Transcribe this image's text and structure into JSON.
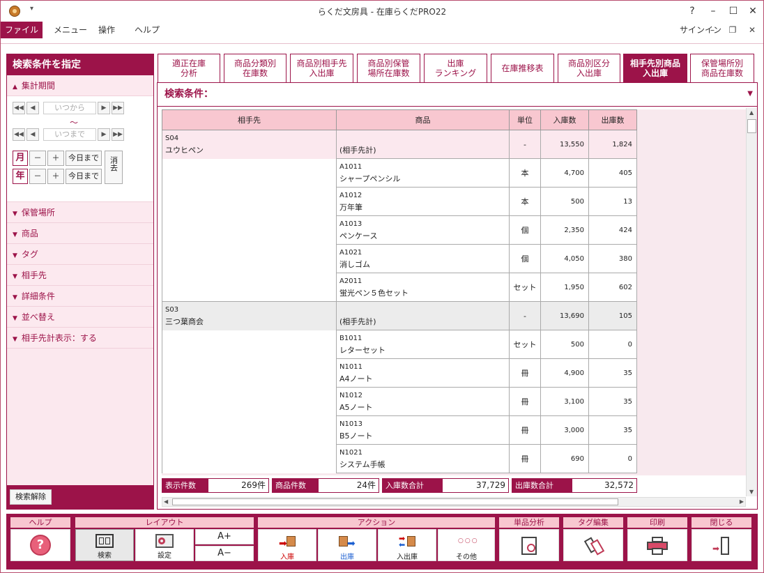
{
  "window": {
    "title": "らくだ文房具 - 在庫らくだPRO22",
    "help": "?",
    "minimize": "–",
    "maximize": "☐",
    "close": "✕"
  },
  "menu": {
    "file": "ファイル",
    "items": [
      "メニュー",
      "操作",
      "ヘルプ"
    ],
    "signin": "サインイン",
    "btn_min": "–",
    "btn_restore": "❐",
    "btn_close": "✕"
  },
  "left": {
    "header": "検索条件を指定",
    "period_label": "集計期間",
    "from_placeholder": "いつから",
    "to_placeholder": "いつまで",
    "tilde": "～",
    "month": "月",
    "year": "年",
    "minus": "－",
    "plus": "＋",
    "today": "今日まで",
    "clear": "消去",
    "sections": [
      "保管場所",
      "商品",
      "タグ",
      "相手先",
      "詳細条件",
      "並べ替え",
      "相手先計表示：する"
    ],
    "clear_search": "検索解除"
  },
  "tabs": [
    "適正在庫\n分析",
    "商品分類別\n在庫数",
    "商品別相手先\n入出庫",
    "商品別保管\n場所在庫数",
    "出庫\nランキング",
    "在庫推移表",
    "商品別区分\n入出庫",
    "相手先別商品\n入出庫",
    "保管場所別\n商品在庫数"
  ],
  "active_tab": 7,
  "main": {
    "search_condition": "検索条件：",
    "columns": [
      "相手先",
      "商品",
      "単位",
      "入庫数",
      "出庫数"
    ],
    "groups": [
      {
        "code": "S04",
        "name": "ユウヒペン",
        "subtotal": {
          "label": "(相手先計)",
          "unit": "-",
          "in": "13,550",
          "out": "1,824"
        },
        "items": [
          {
            "code": "A1011",
            "name": "シャープペンシル",
            "unit": "本",
            "in": "4,700",
            "out": "405"
          },
          {
            "code": "A1012",
            "name": "万年筆",
            "unit": "本",
            "in": "500",
            "out": "13"
          },
          {
            "code": "A1013",
            "name": "ペンケース",
            "unit": "個",
            "in": "2,350",
            "out": "424"
          },
          {
            "code": "A1021",
            "name": "消しゴム",
            "unit": "個",
            "in": "4,050",
            "out": "380"
          },
          {
            "code": "A2011",
            "name": "蛍光ペン５色セット",
            "unit": "セット",
            "in": "1,950",
            "out": "602"
          }
        ]
      },
      {
        "code": "S03",
        "name": "三つ葉商会",
        "subtotal": {
          "label": "(相手先計)",
          "unit": "-",
          "in": "13,690",
          "out": "105"
        },
        "items": [
          {
            "code": "B1011",
            "name": "レターセット",
            "unit": "セット",
            "in": "500",
            "out": "0"
          },
          {
            "code": "N1011",
            "name": "A4ノート",
            "unit": "冊",
            "in": "4,900",
            "out": "35"
          },
          {
            "code": "N1012",
            "name": "A5ノート",
            "unit": "冊",
            "in": "3,100",
            "out": "35"
          },
          {
            "code": "N1013",
            "name": "B5ノート",
            "unit": "冊",
            "in": "3,000",
            "out": "35"
          },
          {
            "code": "N1021",
            "name": "システム手帳",
            "unit": "冊",
            "in": "690",
            "out": "0"
          }
        ]
      }
    ],
    "summary": {
      "count_label": "表示件数",
      "count": "269件",
      "items_label": "商品件数",
      "items": "24件",
      "in_label": "入庫数合計",
      "in_total": "37,729",
      "out_label": "出庫数合計",
      "out_total": "32,572"
    }
  },
  "toolbar": {
    "groups": {
      "help": "ヘルプ",
      "layout": "レイアウト",
      "action": "アクション",
      "analysis": "単品分析",
      "tag": "タグ編集",
      "print": "印刷",
      "close": "閉じる"
    },
    "buttons": {
      "search": "検索",
      "settings": "設定",
      "font_up": "A+",
      "font_down": "A−",
      "in": "入庫",
      "out": "出庫",
      "inout": "入出庫",
      "other": "その他",
      "other_icon": "○○○"
    }
  },
  "colors": {
    "accent": "#9c1349",
    "header": "#f8c7d0",
    "light": "#fbe8ee"
  }
}
